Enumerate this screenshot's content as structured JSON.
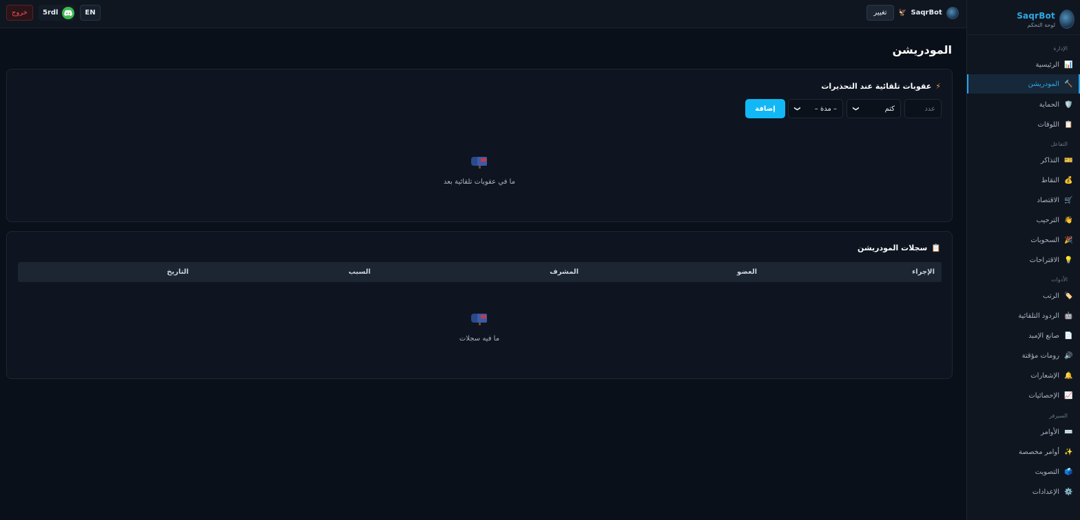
{
  "sidebar": {
    "brand_name": "SaqrBot",
    "brand_sub": "لوحة التحكم",
    "sections": [
      {
        "label": "الإدارة",
        "items": [
          {
            "label": "الرئيسية",
            "icon": "📊"
          },
          {
            "label": "المودريشن",
            "icon": "🔨",
            "active": true
          },
          {
            "label": "الحماية",
            "icon": "🛡️"
          },
          {
            "label": "اللوقات",
            "icon": "📋"
          }
        ]
      },
      {
        "label": "التفاعل",
        "items": [
          {
            "label": "التذاكر",
            "icon": "🎫"
          },
          {
            "label": "النقاط",
            "icon": "💰"
          },
          {
            "label": "الاقتصاد",
            "icon": "🛒"
          },
          {
            "label": "الترحيب",
            "icon": "👋"
          },
          {
            "label": "السحوبات",
            "icon": "🎉"
          },
          {
            "label": "الاقتراحات",
            "icon": "💡"
          }
        ]
      },
      {
        "label": "الأدوات",
        "items": [
          {
            "label": "الرتب",
            "icon": "🏷️"
          },
          {
            "label": "الردود التلقائية",
            "icon": "🤖"
          },
          {
            "label": "صانع الإمبد",
            "icon": "📄"
          },
          {
            "label": "رومات مؤقتة",
            "icon": "🔊"
          },
          {
            "label": "الإشعارات",
            "icon": "🔔"
          },
          {
            "label": "الإحصائيات",
            "icon": "📈"
          }
        ]
      },
      {
        "label": "السيرفر",
        "items": [
          {
            "label": "الأوامر",
            "icon": "⌨️"
          },
          {
            "label": "أوامر مخصصة",
            "icon": "✨"
          },
          {
            "label": "التصويت",
            "icon": "🗳️"
          },
          {
            "label": "الإعدادات",
            "icon": "⚙️"
          }
        ]
      }
    ]
  },
  "topbar": {
    "logout_label": "خروج",
    "username": "5rdl",
    "lang_label": "EN",
    "change_label": "تغيير",
    "bot_name": "SaqrBot"
  },
  "page": {
    "title": "المودريشن"
  },
  "punishments": {
    "title": "عقوبات تلقائية عند التحذيرات",
    "title_icon": "⚡",
    "count_placeholder": "عدد",
    "action_value": "كتم",
    "duration_value": "– مدة –",
    "add_label": "إضافة",
    "empty_text": "ما في عقوبات تلقائية بعد"
  },
  "logs": {
    "title": "سجلات المودريشن",
    "title_icon": "📋",
    "columns": [
      "الإجراء",
      "العضو",
      "المشرف",
      "السبب",
      "التاريخ"
    ],
    "empty_text": "ما فيه سجلات"
  },
  "colors": {
    "accent": "#12b8f5",
    "danger": "#f0515f",
    "discord_green": "#3fb950"
  }
}
